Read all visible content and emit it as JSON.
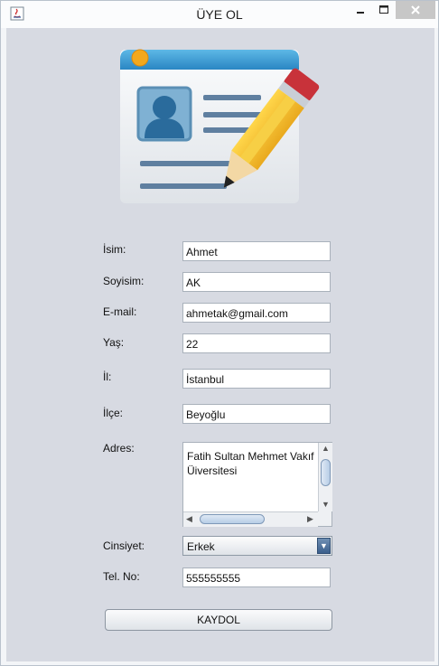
{
  "window": {
    "title": "ÜYE OL",
    "min_glyph": "—",
    "max_glyph": "☐",
    "close_glyph": "✕"
  },
  "hero": {
    "icon": "contact-card-pencil-icon"
  },
  "form": {
    "name": {
      "label": "İsim:",
      "value": "Ahmet"
    },
    "surname": {
      "label": "Soyisim:",
      "value": "AK"
    },
    "email": {
      "label": "E-mail:",
      "value": "ahmetak@gmail.com"
    },
    "age": {
      "label": "Yaş:",
      "value": "22"
    },
    "city": {
      "label": "İl:",
      "value": "İstanbul"
    },
    "district": {
      "label": "İlçe:",
      "value": "Beyoğlu"
    },
    "address": {
      "label": "Adres:",
      "value": "Fatih Sultan Mehmet Vakıf Üiversitesi"
    },
    "gender": {
      "label": "Cinsiyet:",
      "value": "Erkek"
    },
    "phone": {
      "label": "Tel. No:",
      "value": "555555555"
    },
    "submit_label": "KAYDOL"
  },
  "colors": {
    "panel_bg": "#d7dae2",
    "card_header": "#3aa0d8",
    "pencil_body": "#f5c230",
    "eraser": "#c8323a"
  }
}
